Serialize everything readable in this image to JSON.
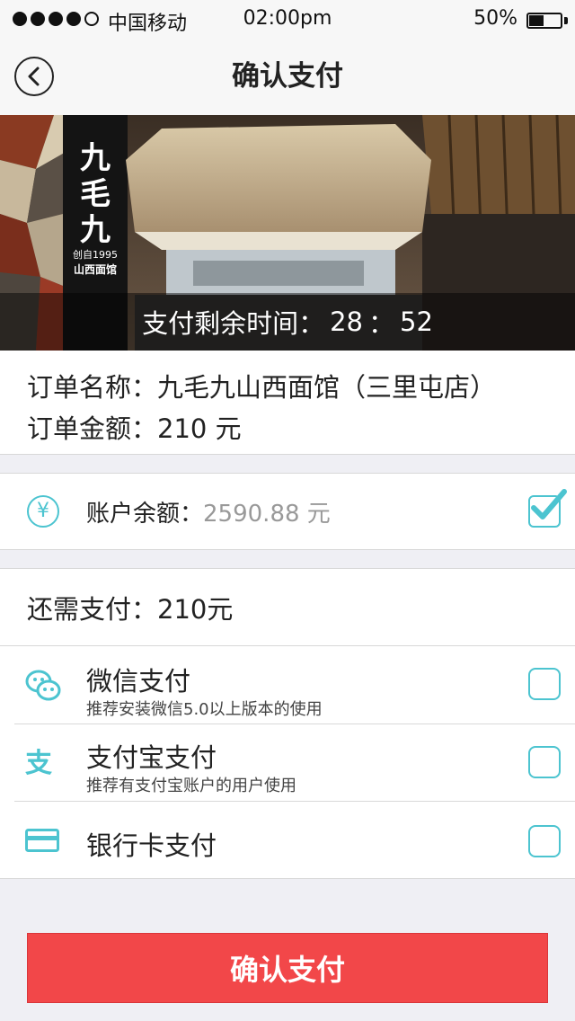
{
  "status_bar": {
    "carrier": "中国移动",
    "time": "02:00pm",
    "battery": "50%",
    "battery_level": 0.5
  },
  "nav": {
    "title": "确认支付",
    "back_icon": "chevron-left-icon"
  },
  "banner": {
    "logo_lines": [
      "九",
      "毛",
      "九"
    ],
    "logo_since": "创自1995",
    "logo_brand": "山西面馆",
    "countdown_label": "支付剩余时间：",
    "countdown_minutes": "28",
    "countdown_sep": "：",
    "countdown_seconds": "52"
  },
  "order": {
    "name_label": "订单名称：",
    "name_value": "九毛九山西面馆（三里屯店）",
    "amount_label": "订单金额：",
    "amount_value": "210 元"
  },
  "balance": {
    "icon": "yen-icon",
    "label": "账户余额：",
    "value": "2590.88 元",
    "checked": true
  },
  "payment": {
    "remaining_label": "还需支付：",
    "remaining_value": "210元",
    "methods": [
      {
        "icon": "wechat-icon",
        "title": "微信支付",
        "subtitle": "推荐安装微信5.0以上版本的使用",
        "checked": false
      },
      {
        "icon": "alipay-icon",
        "title": "支付宝支付",
        "subtitle": "推荐有支付宝账户的用户使用",
        "checked": false
      },
      {
        "icon": "bank-card-icon",
        "title": "银行卡支付",
        "subtitle": "",
        "checked": false
      }
    ]
  },
  "confirm_button": "确认支付",
  "colors": {
    "accent": "#4cc4d0",
    "confirm": "#f24749",
    "background": "#efeff4"
  }
}
